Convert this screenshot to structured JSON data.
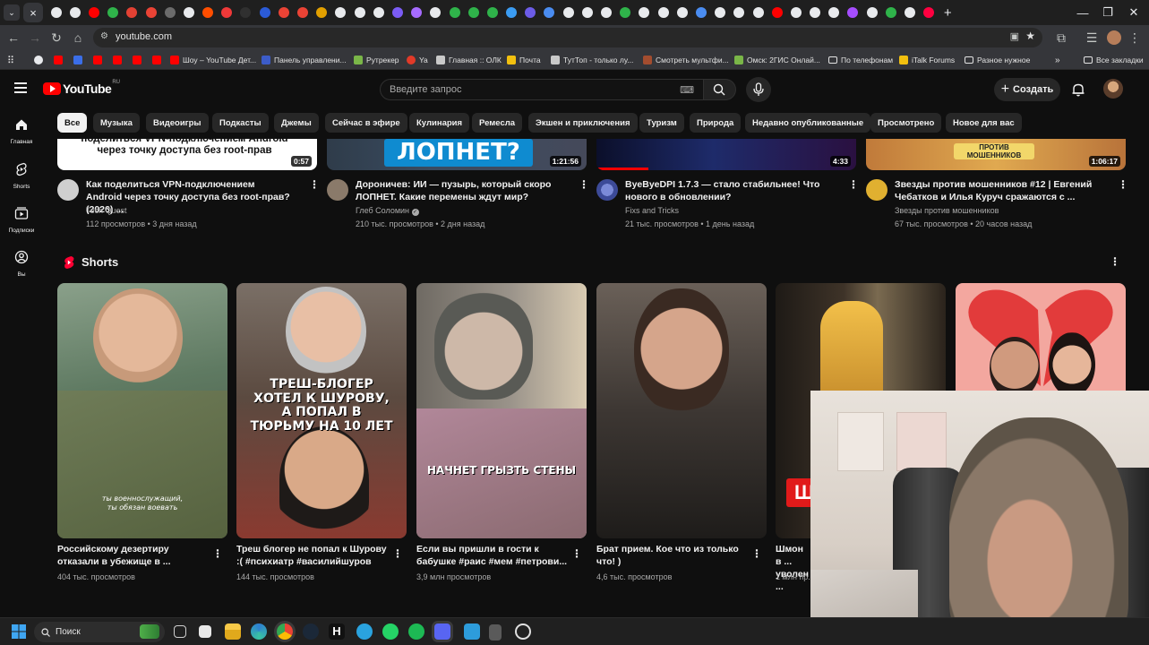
{
  "browser": {
    "url": "youtube.com",
    "tab_close": "×",
    "new_tab": "+",
    "tab_icon_colors": [
      "#e8eaed",
      "#e8eaed",
      "#ff0000",
      "#2fb34a",
      "#e34133",
      "#ea4335",
      "#6b6b6b",
      "#e8eaed",
      "#ff4e00",
      "#ef3939",
      "#303030",
      "#2b5bd8",
      "#ea4335",
      "#ea4335",
      "#e2a000",
      "#e8eaed",
      "#e8eaed",
      "#e8eaed",
      "#7b5cf5",
      "#a66bff",
      "#e8eaed",
      "#2fb34a",
      "#2fb34a",
      "#2fb34a",
      "#3b9cf2",
      "#6c5ce7",
      "#4a8cf0",
      "#e8eaed",
      "#e8eaed",
      "#e8eaed",
      "#2fb34a",
      "#e8eaed",
      "#e8eaed",
      "#e8eaed",
      "#4a8cf0",
      "#e8eaed",
      "#e8eaed",
      "#e8eaed",
      "#ff0000",
      "#e8eaed",
      "#e8eaed",
      "#e8eaed",
      "#a64dff",
      "#e8eaed",
      "#2fb34a",
      "#e8eaed",
      "#ff0040"
    ]
  },
  "bookmarks": [
    {
      "label": "Шоу – YouTube Дет...",
      "color": "#ff0000"
    },
    {
      "label": "Панель управлени...",
      "color": "#3c5cc8"
    },
    {
      "label": "Рутрекер",
      "color": "#7ab648"
    },
    {
      "label": "Ya",
      "color": "#e23a28"
    },
    {
      "label": "Главная :: ОЛК",
      "color": "#e8eaed"
    },
    {
      "label": "Почта",
      "color": "#f2c00f"
    },
    {
      "label": "ТутТоп - только лу...",
      "color": "#e8eaed"
    },
    {
      "label": "Смотреть мультфи...",
      "color": "#a34d2f"
    },
    {
      "label": "Омск: 2ГИС Онлай...",
      "color": "#7ab648"
    },
    {
      "label": "По телефонам",
      "color": "#e8eaed"
    },
    {
      "label": "iTalk Forums",
      "color": "#f2c00f"
    },
    {
      "label": "Разное нужное",
      "color": "#e8eaed"
    },
    {
      "label": "Все закладки",
      "color": "#e8eaed"
    }
  ],
  "youtube": {
    "logo_text": "YouTube",
    "region": "RU",
    "search_placeholder": "Введите запрос",
    "create_label": "Создать",
    "sidebar": [
      {
        "label": "Главная",
        "icon": "home-icon"
      },
      {
        "label": "Shorts",
        "icon": "shorts-icon"
      },
      {
        "label": "Подписки",
        "icon": "subscriptions-icon"
      },
      {
        "label": "Вы",
        "icon": "you-icon"
      }
    ],
    "chips": [
      "Все",
      "Музыка",
      "Видеоигры",
      "Подкасты",
      "Джемы",
      "Сейчас в эфире",
      "Кулинария",
      "Ремесла",
      "Экшен и приключения",
      "Туризм",
      "Природа",
      "Недавно опубликованные",
      "Просмотрено",
      "Новое для вас"
    ],
    "videos": [
      {
        "thumb_text": "поделиться VPN-подключением Android через точку доступа без root-прав",
        "duration": "0:57",
        "title": "Как поделиться VPN-подключением Android через точку доступа без root-прав? (2026) ...",
        "channel": "Tech Quest",
        "meta": "112 просмотров • 3 дня назад",
        "verified": false,
        "avatar_color": "#c9c9c9"
      },
      {
        "thumb_text": "ЛОПНЕТ?",
        "duration": "1:21:56",
        "title": "Дороничев: ИИ — пузырь, который скоро ЛОПНЕТ. Какие перемены ждут мир?",
        "channel": "Глеб Соломин",
        "meta": "210 тыс. просмотров • 2 дня назад",
        "verified": true,
        "avatar_color": "#8a7a6a"
      },
      {
        "thumb_text": "",
        "duration": "4:33",
        "title": "ByeByeDPI 1.7.3 — стало стабильнее! Что нового в обновлении?",
        "channel": "Fixs and Tricks",
        "meta": "21 тыс. просмотров • 1 день назад",
        "verified": false,
        "avatar_color": "#5a6fb0"
      },
      {
        "thumb_text": "ПРОТИВ МОШЕННИКОВ",
        "duration": "1:06:17",
        "title": "Звезды против мошенников #12 | Евгений Чебатков и Илья Куруч сражаются с ...",
        "channel": "Звезды против мошенников",
        "meta": "67 тыс. просмотров • 20 часов назад",
        "verified": false,
        "avatar_color": "#e0b030"
      }
    ],
    "shorts_heading": "Shorts",
    "shorts": [
      {
        "title": "Российскому дезертиру отказали в убежище в ...",
        "views": "404 тыс. просмотров",
        "overlay": "ты военнослужащий,\nты обязан воевать",
        "bg": "#5f7a62"
      },
      {
        "title": "Треш блогер не попал к Шурову :( #психиатр #василийшуров",
        "views": "144 тыс. просмотров",
        "overlay": "ТРЕШ-БЛОГЕР ХОТЕЛ К ШУРОВУ, А ПОПАЛ В ТЮРЬМУ НА 10 ЛЕТ",
        "bg": "#6b4a3a"
      },
      {
        "title": "Если вы пришли в гости к бабушке #раис #мем #петрови...",
        "views": "3,9 млн просмотров",
        "overlay": "НАЧНЕТ ГРЫЗТЬ СТЕНЫ",
        "bg": "#8d857c"
      },
      {
        "title": "Брат прием. Кое что из только что! )",
        "views": "4,6 тыс. просмотров",
        "overlay": "",
        "bg": "#3a3532"
      },
      {
        "title": "Шмон в ... уволен ...",
        "views": "1 млн пр...",
        "overlay": "Ш",
        "bg": "#2e2620"
      },
      {
        "title": "",
        "views": "",
        "overlay": "",
        "bg": "#f1a7a0"
      }
    ]
  },
  "taskbar": {
    "search_label": "Поиск"
  }
}
